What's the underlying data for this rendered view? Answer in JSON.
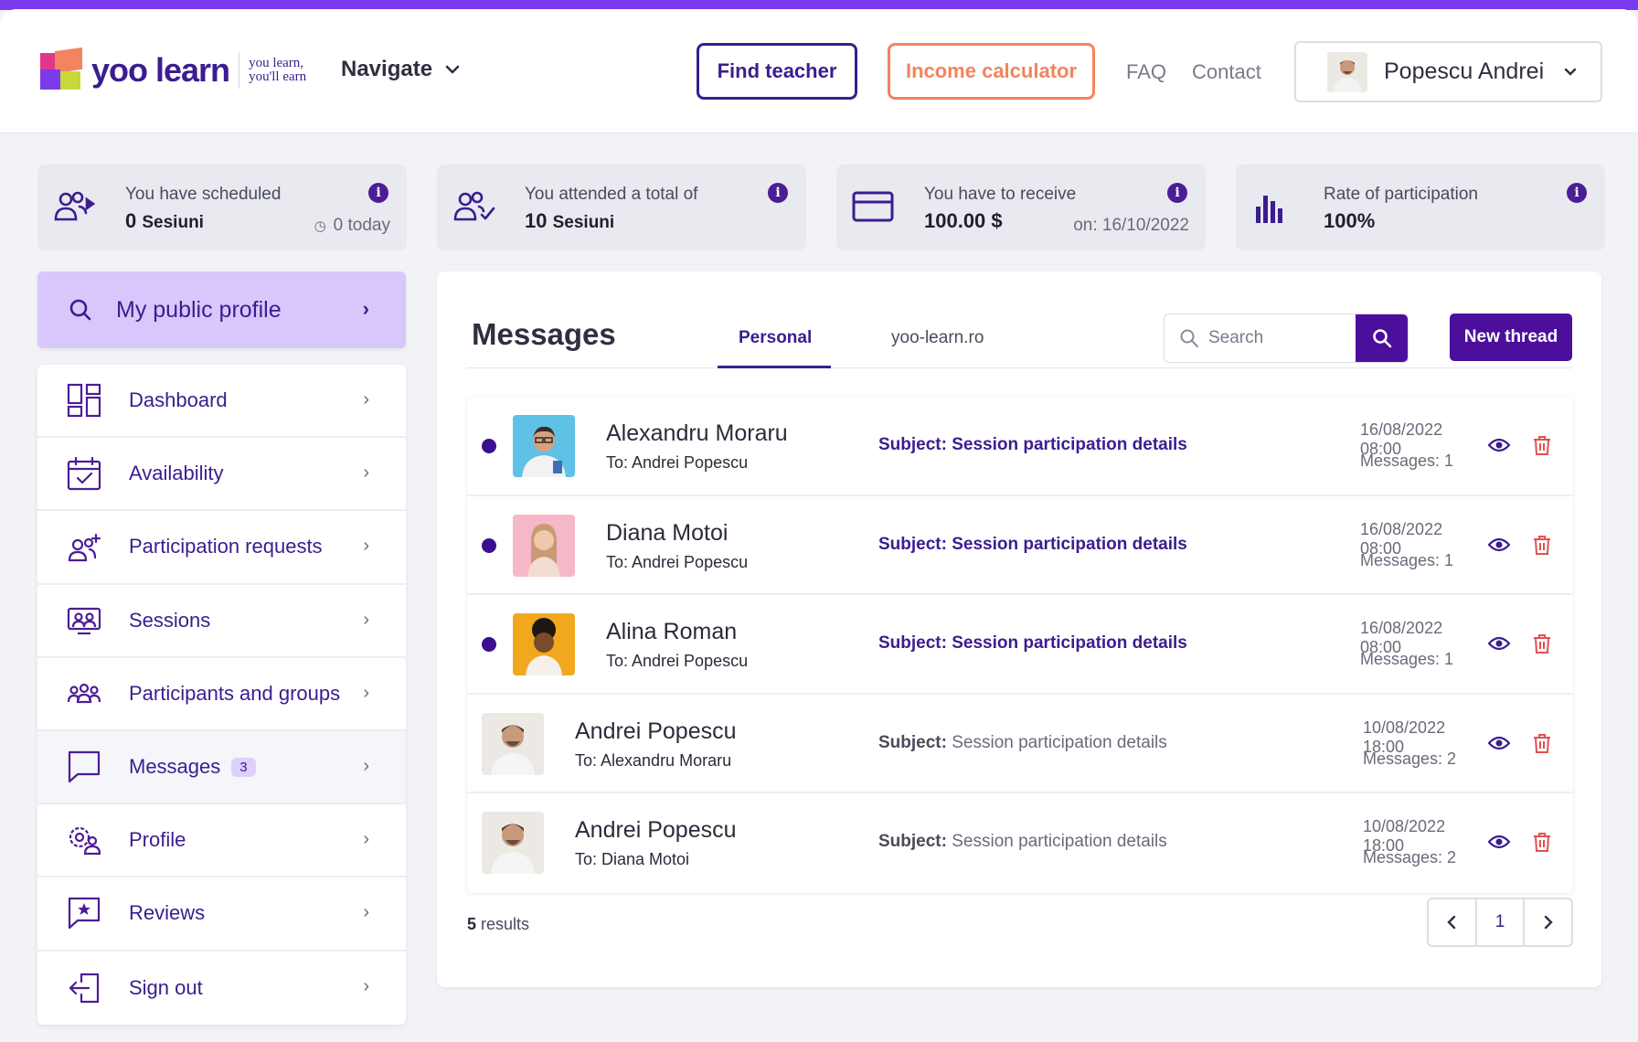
{
  "header": {
    "logo_word": "yoo learn",
    "logo_tag_line1": "you learn,",
    "logo_tag_line2": "you'll earn",
    "navigate_label": "Navigate",
    "find_teacher": "Find teacher",
    "income_calculator": "Income calculator",
    "faq": "FAQ",
    "contact": "Contact",
    "user_name": "Popescu Andrei"
  },
  "stats": [
    {
      "label": "You have scheduled",
      "value": "0",
      "unit": "Sesiuni",
      "sub": "0 today",
      "icon": "users-arrow-icon"
    },
    {
      "label": "You attended a total of",
      "value": "10",
      "unit": "Sesiuni",
      "sub": "",
      "icon": "users-check-icon"
    },
    {
      "label": "You have to receive",
      "value": "100.00 $",
      "unit": "",
      "sub": "on: 16/10/2022",
      "icon": "credit-card-icon"
    },
    {
      "label": "Rate of participation",
      "value": "100%",
      "unit": "",
      "sub": "",
      "icon": "bar-chart-icon"
    }
  ],
  "sidebar": {
    "profile_label": "My public profile",
    "items": [
      {
        "label": "Dashboard",
        "icon": "dashboard-icon"
      },
      {
        "label": "Availability",
        "icon": "calendar-check-icon"
      },
      {
        "label": "Participation requests",
        "icon": "user-add-icon"
      },
      {
        "label": "Sessions",
        "icon": "sessions-icon"
      },
      {
        "label": "Participants and groups",
        "icon": "group-icon"
      },
      {
        "label": "Messages",
        "icon": "message-icon",
        "badge": "3"
      },
      {
        "label": "Profile",
        "icon": "profile-gear-icon"
      },
      {
        "label": "Reviews",
        "icon": "review-star-icon"
      },
      {
        "label": "Sign out",
        "icon": "sign-out-icon"
      }
    ]
  },
  "messages": {
    "title": "Messages",
    "tabs": [
      "Personal",
      "yoo-learn.ro"
    ],
    "active_tab": "Personal",
    "search_placeholder": "Search",
    "new_thread": "New thread",
    "subject_prefix": "Subject:",
    "rows": [
      {
        "unread": true,
        "sender": "Alexandru Moraru",
        "to": "To: Andrei Popescu",
        "subject": "Session participation details",
        "date": "16/08/2022 08:00",
        "count": "Messages: 1"
      },
      {
        "unread": true,
        "sender": "Diana Motoi",
        "to": "To: Andrei Popescu",
        "subject": "Session participation details",
        "date": "16/08/2022 08:00",
        "count": "Messages: 1"
      },
      {
        "unread": true,
        "sender": "Alina Roman",
        "to": "To: Andrei Popescu",
        "subject": "Session participation details",
        "date": "16/08/2022 08:00",
        "count": "Messages: 1"
      },
      {
        "unread": false,
        "sender": "Andrei Popescu",
        "to": "To: Alexandru Moraru",
        "subject": "Session participation details",
        "date": "10/08/2022 18:00",
        "count": "Messages: 2"
      },
      {
        "unread": false,
        "sender": "Andrei Popescu",
        "to": "To: Diana Motoi",
        "subject": "Session participation details",
        "date": "10/08/2022 18:00",
        "count": "Messages: 2"
      }
    ],
    "results_count": "5",
    "results_word": "results",
    "page": "1"
  },
  "colors": {
    "accent": "#4c0f9c",
    "accent_text": "#3b1d8f",
    "income": "#f2845e",
    "profile_highlight": "#d8c7fb",
    "delete": "#e2504f"
  }
}
